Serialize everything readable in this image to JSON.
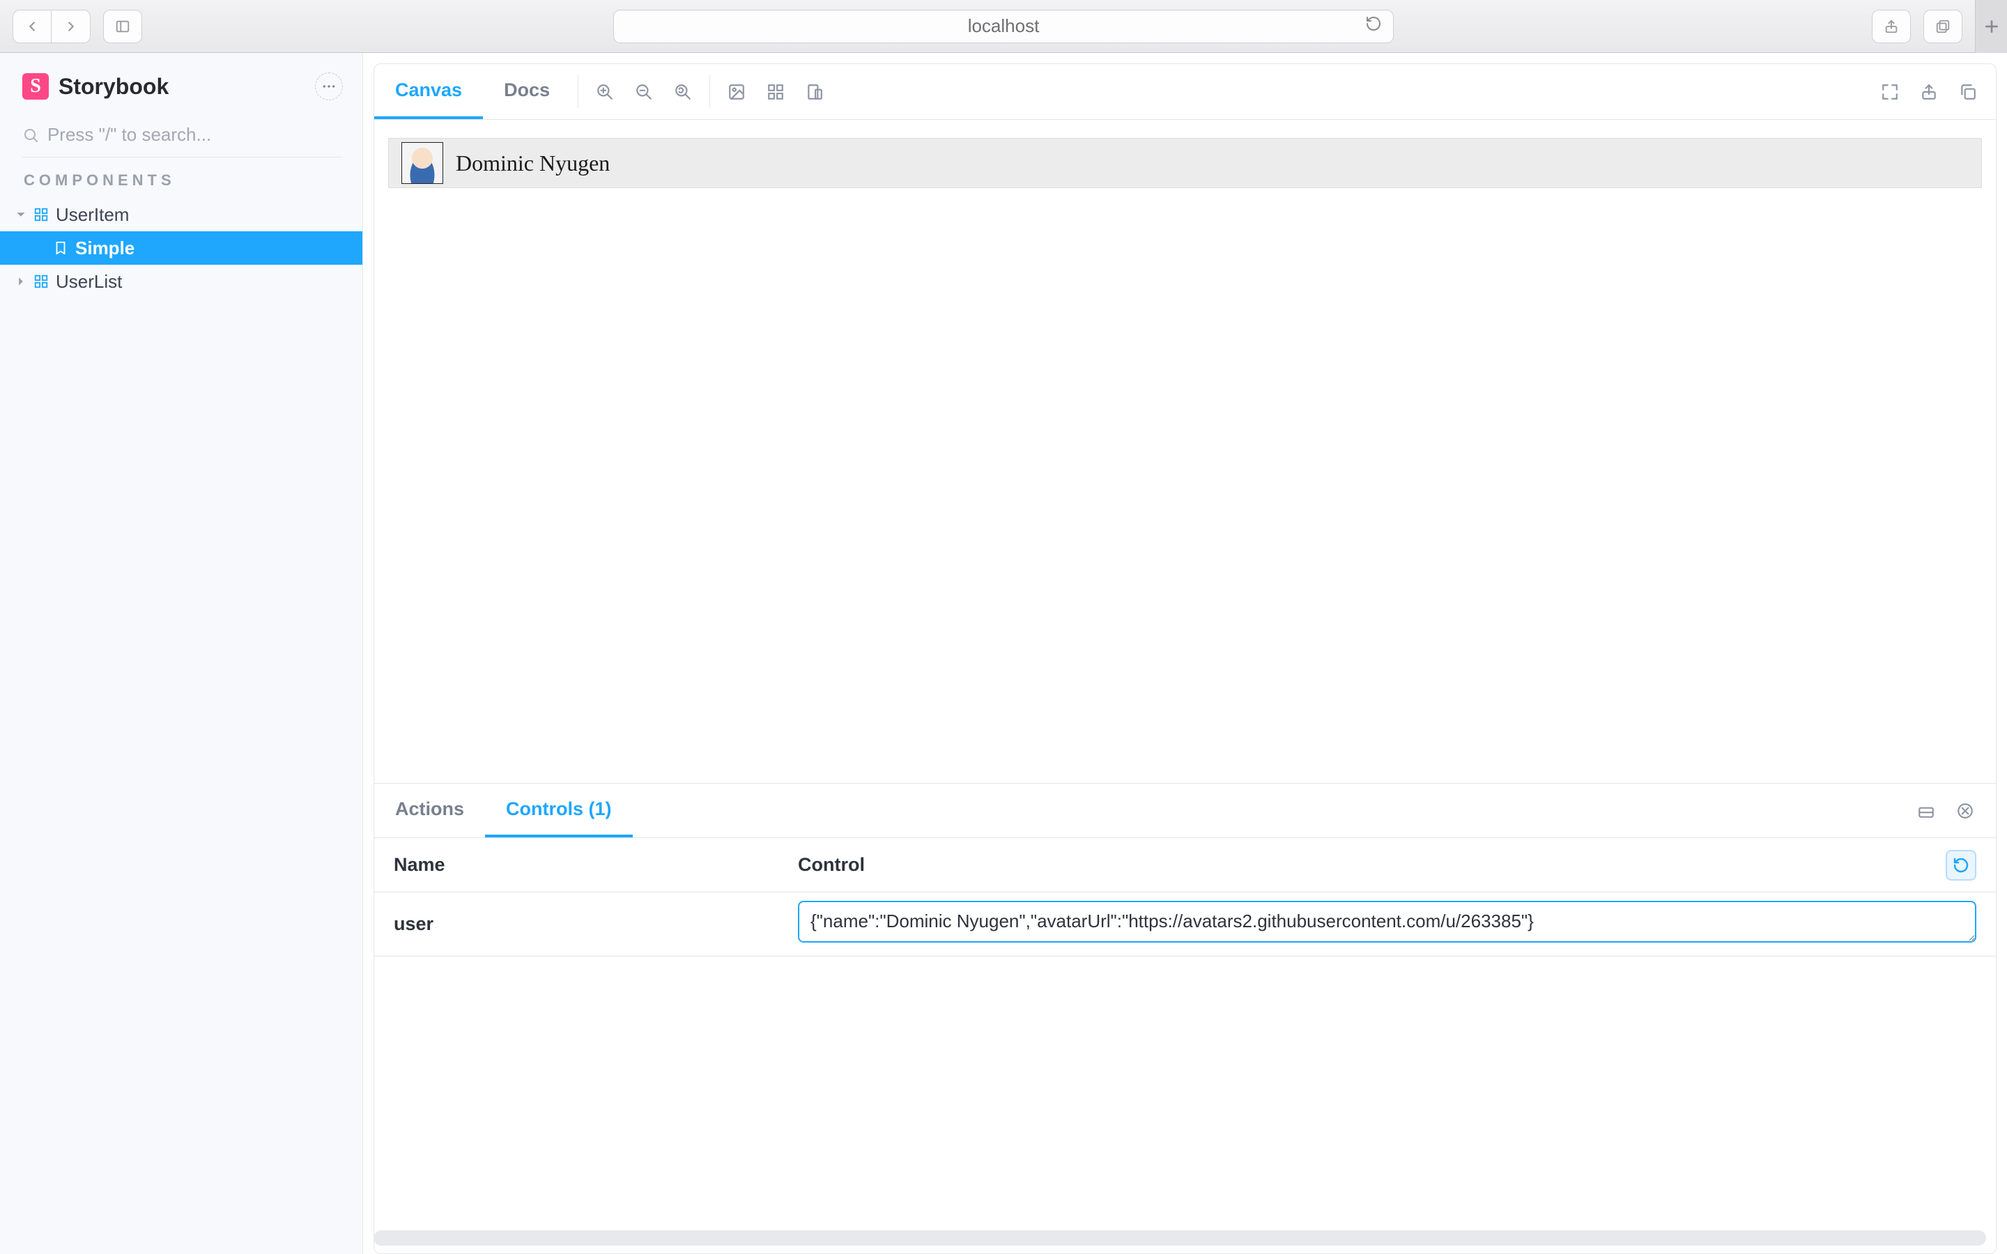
{
  "browser": {
    "url": "localhost"
  },
  "brand": {
    "badge": "S",
    "name": "Storybook"
  },
  "search": {
    "placeholder": "Press \"/\" to search..."
  },
  "sidebar": {
    "section_label": "COMPONENTS",
    "items": [
      {
        "label": "UserItem",
        "kind": "component",
        "expanded": true
      },
      {
        "label": "Simple",
        "kind": "story",
        "selected": true
      },
      {
        "label": "UserList",
        "kind": "component",
        "expanded": false
      }
    ]
  },
  "toolbar": {
    "tabs": {
      "canvas": "Canvas",
      "docs": "Docs"
    }
  },
  "preview": {
    "user_name": "Dominic Nyugen"
  },
  "addons": {
    "tabs": {
      "actions": "Actions",
      "controls": "Controls (1)"
    },
    "columns": {
      "name": "Name",
      "control": "Control"
    },
    "rows": [
      {
        "name": "user",
        "value": "{\"name\":\"Dominic Nyugen\",\"avatarUrl\":\"https://avatars2.githubusercontent.com/u/263385\"}"
      }
    ]
  }
}
